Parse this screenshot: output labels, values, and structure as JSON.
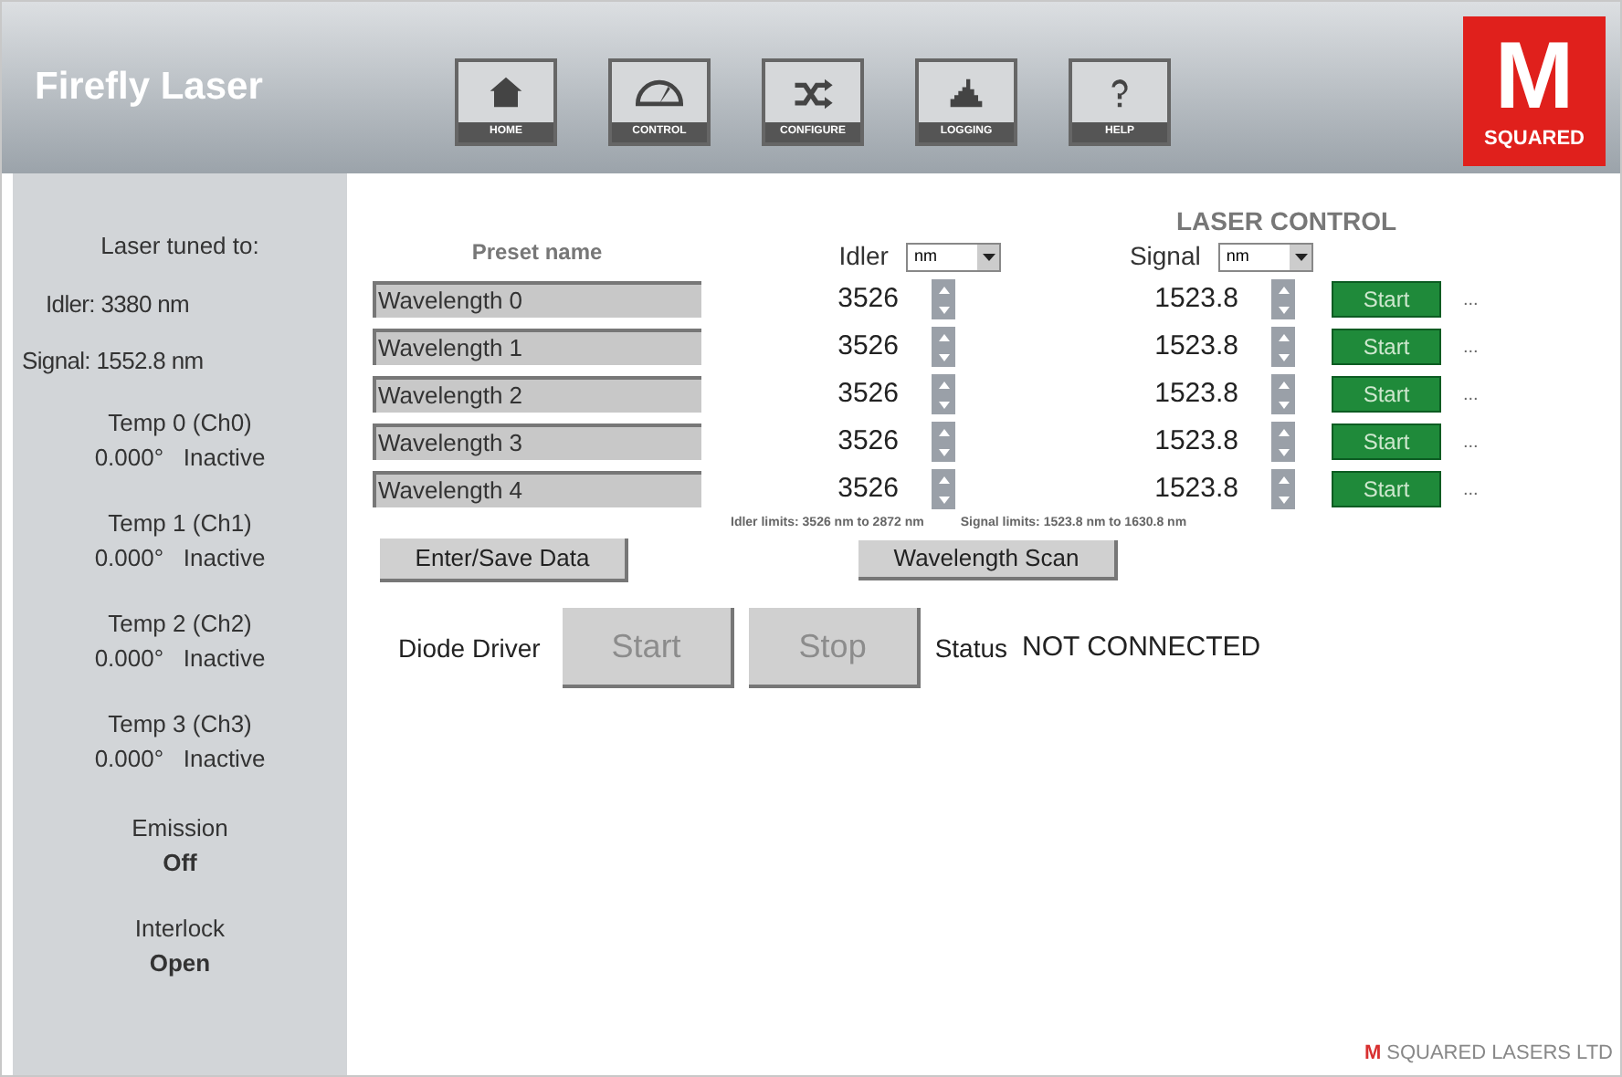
{
  "header": {
    "title": "Firefly Laser",
    "logo": {
      "letter": "M",
      "word": "SQUARED"
    }
  },
  "nav": [
    {
      "label": "HOME",
      "kind": "home",
      "selected": false
    },
    {
      "label": "CONTROL",
      "kind": "gauge",
      "selected": false
    },
    {
      "label": "CONFIGURE",
      "kind": "shuffle",
      "selected": false
    },
    {
      "label": "LOGGING",
      "kind": "bars",
      "selected": false
    },
    {
      "label": "HELP",
      "kind": "help",
      "selected": false
    }
  ],
  "sidebar": {
    "tuned_label": "Laser tuned to:",
    "idler": "Idler: 3380 nm",
    "signal": "Signal: 1552.8 nm",
    "temps": [
      {
        "name": "Temp 0 (Ch0)",
        "reading": "0.000°   Inactive"
      },
      {
        "name": "Temp 1 (Ch1)",
        "reading": "0.000°   Inactive"
      },
      {
        "name": "Temp 2 (Ch2)",
        "reading": "0.000°   Inactive"
      },
      {
        "name": "Temp 3 (Ch3)",
        "reading": "0.000°   Inactive"
      }
    ],
    "emission": {
      "label": "Emission",
      "value": "Off"
    },
    "interlock": {
      "label": "Interlock",
      "value": "Open"
    }
  },
  "control": {
    "title": "LASER CONTROL",
    "preset_header": "Preset name",
    "idler_header": "Idler",
    "idler_unit": "nm",
    "signal_header": "Signal",
    "signal_unit": "nm",
    "rows": [
      {
        "name": "Wavelength 0",
        "idler": "3526",
        "signal": "1523.8",
        "button": "Start",
        "more": "..."
      },
      {
        "name": "Wavelength 1",
        "idler": "3526",
        "signal": "1523.8",
        "button": "Start",
        "more": "..."
      },
      {
        "name": "Wavelength 2",
        "idler": "3526",
        "signal": "1523.8",
        "button": "Start",
        "more": "..."
      },
      {
        "name": "Wavelength 3",
        "idler": "3526",
        "signal": "1523.8",
        "button": "Start",
        "more": "..."
      },
      {
        "name": "Wavelength 4",
        "idler": "3526",
        "signal": "1523.8",
        "button": "Start",
        "more": "..."
      }
    ],
    "idler_limits": "Idler limits: 3526 nm to 2872 nm",
    "signal_limits": "Signal limits: 1523.8 nm to 1630.8 nm",
    "save_button": "Enter/Save Data",
    "scan_button": "Wavelength Scan"
  },
  "diode": {
    "label": "Diode Driver",
    "start": {
      "label": "Start",
      "disabled": true
    },
    "stop": {
      "label": "Stop",
      "disabled": true
    },
    "status_label": "Status",
    "status": "NOT CONNECTED"
  },
  "footer": {
    "letter": "M",
    "company": "SQUARED LASERS LTD"
  }
}
